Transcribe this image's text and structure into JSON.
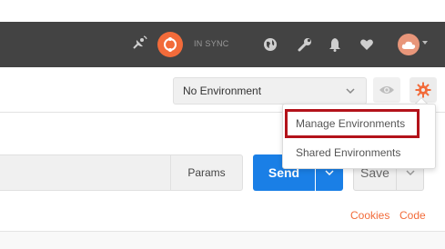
{
  "header": {
    "sync_status": "IN SYNC",
    "icons": [
      "satellite-icon",
      "sync-icon",
      "globe-icon",
      "wrench-icon",
      "bell-icon",
      "heart-icon",
      "avatar-cloud-icon"
    ]
  },
  "environment": {
    "selected": "No Environment"
  },
  "request": {
    "params_label": "Params",
    "send_label": "Send",
    "save_label": "Save"
  },
  "links": {
    "cookies": "Cookies",
    "code": "Code"
  },
  "dropdown": {
    "items": [
      {
        "label": "Manage Environments"
      },
      {
        "label": "Shared Environments"
      }
    ]
  },
  "colors": {
    "header_bg": "#434343",
    "accent_orange": "#f26b3a",
    "send_blue": "#1a7fe6",
    "highlight_red": "#b3121a"
  }
}
